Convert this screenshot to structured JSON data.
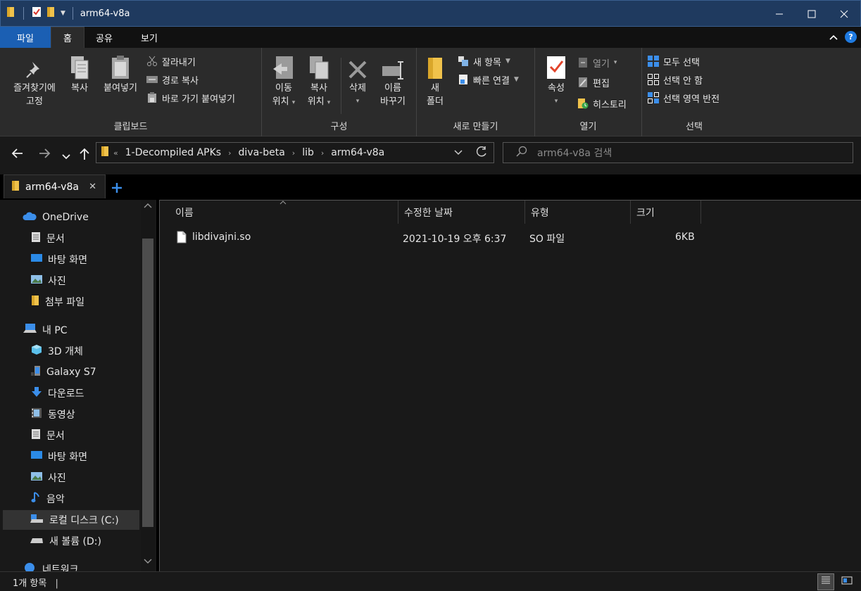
{
  "window": {
    "title": "arm64-v8a"
  },
  "ribbon_tabs": [
    "파일",
    "홈",
    "공유",
    "보기"
  ],
  "ribbon": {
    "clipboard": {
      "pin_label_1": "즐겨찾기에",
      "pin_label_2": "고정",
      "copy": "복사",
      "paste": "붙여넣기",
      "cut": "잘라내기",
      "copy_path": "경로 복사",
      "paste_shortcut": "바로 가기 붙여넣기",
      "group": "클립보드"
    },
    "organize": {
      "move_1": "이동",
      "move_2": "위치",
      "copy_1": "복사",
      "copy_2": "위치",
      "delete": "삭제",
      "rename_1": "이름",
      "rename_2": "바꾸기",
      "group": "구성"
    },
    "new": {
      "new_item": "새 항목",
      "easy_access": "빠른 연결",
      "new_folder_1": "새",
      "new_folder_2": "폴더",
      "group": "새로 만들기"
    },
    "open": {
      "properties": "속성",
      "open": "열기",
      "edit": "편집",
      "history": "히스토리",
      "group": "열기"
    },
    "select": {
      "select_all": "모두 선택",
      "select_none": "선택 안 함",
      "invert": "선택 영역 반전",
      "group": "선택"
    }
  },
  "address": {
    "overflow": "«",
    "crumbs": [
      "1-Decompiled APKs",
      "diva-beta",
      "lib",
      "arm64-v8a"
    ],
    "search_placeholder": "arm64-v8a 검색"
  },
  "tab": {
    "label": "arm64-v8a"
  },
  "nav": {
    "items": [
      {
        "label": "OneDrive"
      },
      {
        "label": "문서"
      },
      {
        "label": "바탕 화면"
      },
      {
        "label": "사진"
      },
      {
        "label": "첨부 파일"
      },
      {
        "label": "내 PC"
      },
      {
        "label": "3D 개체"
      },
      {
        "label": "Galaxy S7"
      },
      {
        "label": "다운로드"
      },
      {
        "label": "동영상"
      },
      {
        "label": "문서"
      },
      {
        "label": "바탕 화면"
      },
      {
        "label": "사진"
      },
      {
        "label": "음악"
      },
      {
        "label": "로컬 디스크 (C:)"
      },
      {
        "label": "새 볼륨 (D:)"
      },
      {
        "label": "네트워크"
      }
    ]
  },
  "columns": [
    "이름",
    "수정한 날짜",
    "유형",
    "크기"
  ],
  "files": [
    {
      "name": "libdivajni.so",
      "modified": "2021-10-19 오후 6:37",
      "type": "SO 파일",
      "size": "6KB"
    }
  ],
  "status": {
    "count": "1개 항목"
  },
  "colors": {
    "title_bg": "#1f3a5f",
    "file_tab": "#1b5fb3",
    "folder": "#f0c24b",
    "accent": "#3b8eea"
  }
}
